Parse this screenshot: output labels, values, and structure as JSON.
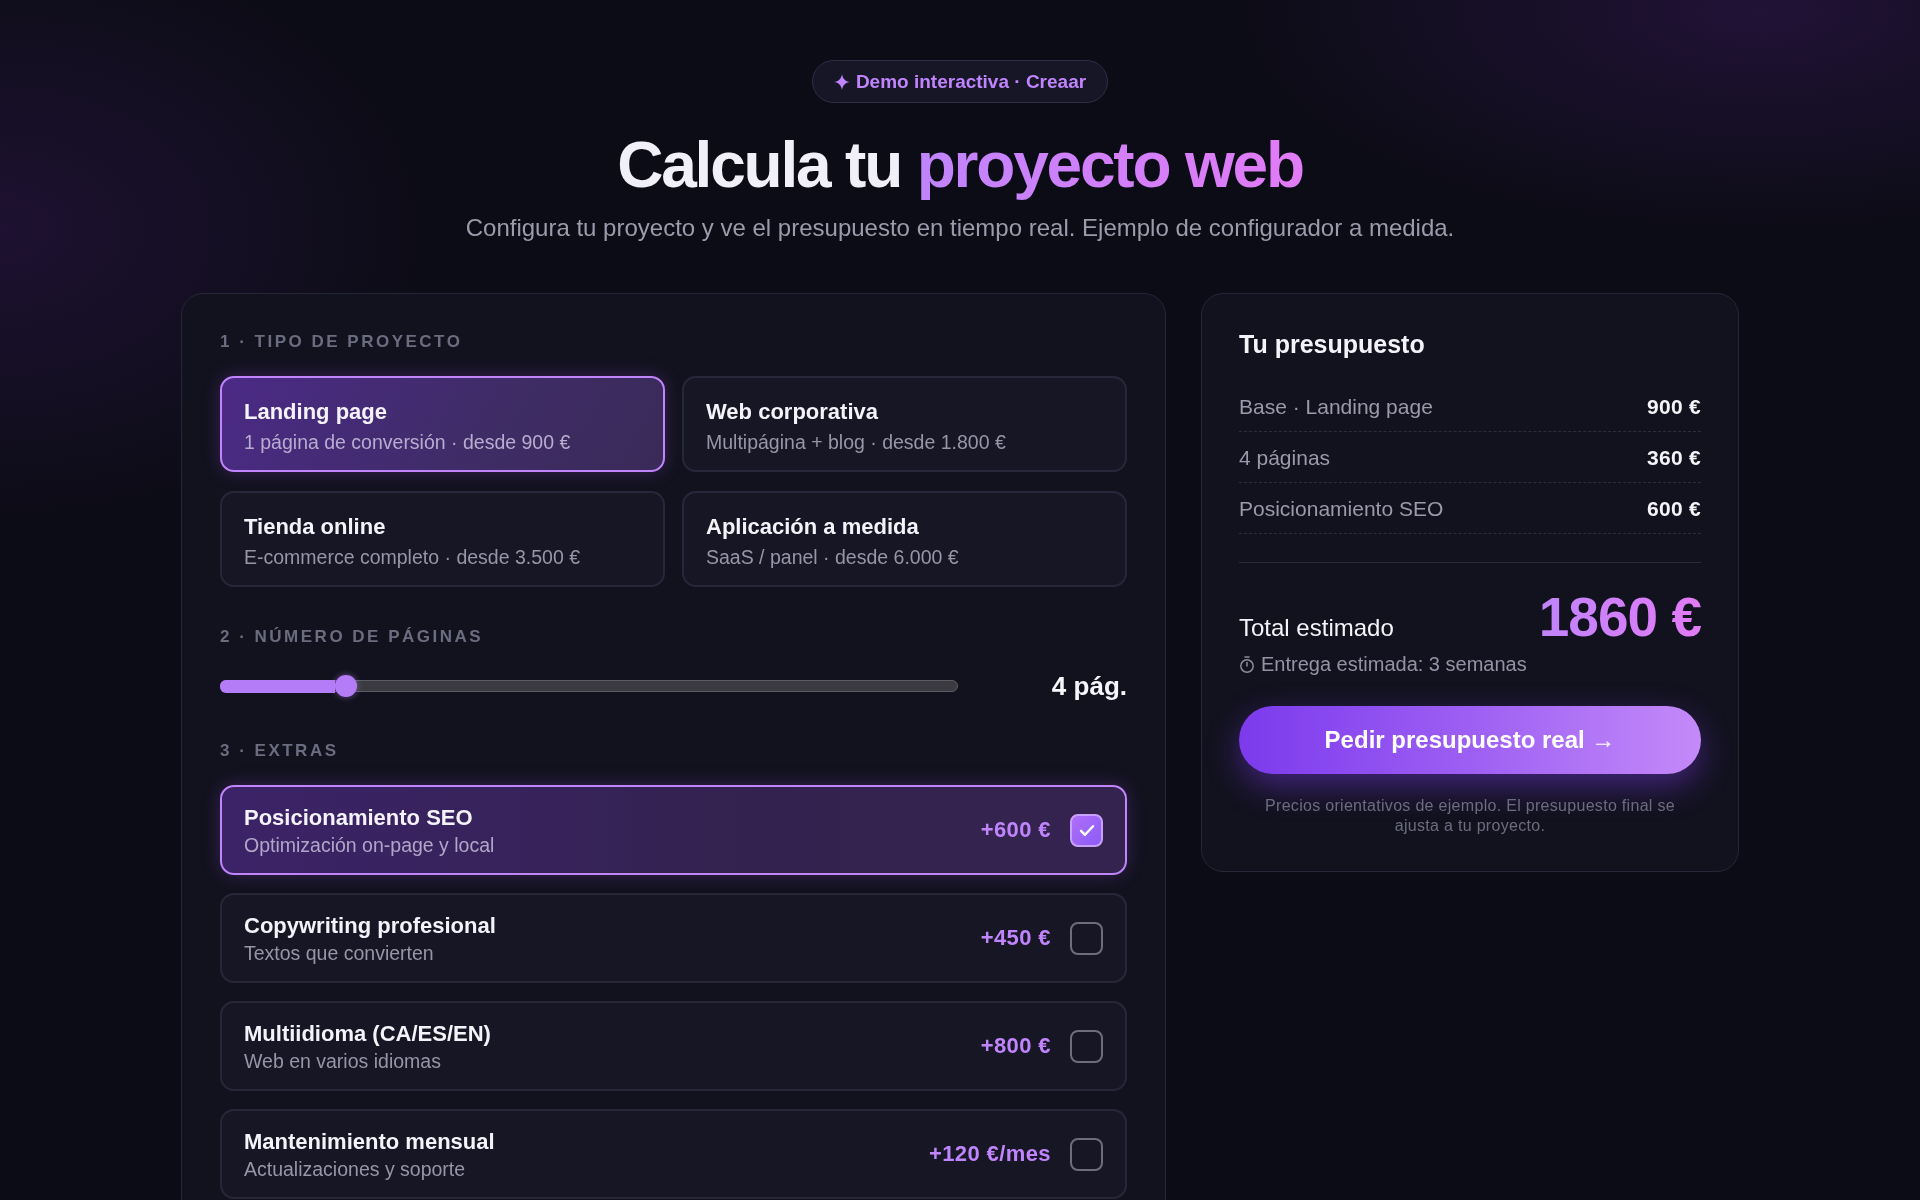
{
  "badge": {
    "text": "Demo interactiva · Creaar"
  },
  "title": {
    "text": "Calcula tu",
    "highlight": "proyecto web"
  },
  "subtitle": "Configura tu proyecto y ve el presupuesto en tiempo real. Ejemplo de configurador a medida.",
  "configurator": {
    "sections": [
      {
        "kind": "options",
        "label": "1 · TIPO DE PROYECTO",
        "options": [
          {
            "title": "Landing page",
            "description": "1 página de conversión · desde 900 €",
            "selected": true
          },
          {
            "title": "Web corporativa",
            "description": "Multipágina + blog · desde 1.800 €",
            "selected": false
          },
          {
            "title": "Tienda online",
            "description": "E-commerce completo · desde 3.500 €",
            "selected": false
          },
          {
            "title": "Aplicación a medida",
            "description": "SaaS / panel · desde 6.000 €",
            "selected": false
          }
        ]
      },
      {
        "kind": "slider",
        "label": "2 · NÚMERO DE PÁGINAS",
        "level": 0.17,
        "reading": "4 pág."
      },
      {
        "kind": "extras",
        "label": "3 · EXTRAS",
        "items": [
          {
            "title": "Posicionamiento SEO",
            "description": "Optimización on-page y local",
            "price": "+600 €",
            "checked": true
          },
          {
            "title": "Copywriting profesional",
            "description": "Textos que convierten",
            "price": "+450 €",
            "checked": false
          },
          {
            "title": "Multiidioma (CA/ES/EN)",
            "description": "Web en varios idiomas",
            "price": "+800 €",
            "checked": false
          },
          {
            "title": "Mantenimiento mensual",
            "description": "Actualizaciones y soporte",
            "price": "+120 €/mes",
            "checked": false
          }
        ]
      }
    ]
  },
  "summary": {
    "title": "Tu presupuesto",
    "lines": [
      {
        "label": "Base · Landing page",
        "amount": "900 €"
      },
      {
        "label": "4 páginas",
        "amount": "360 €"
      },
      {
        "label": "Posicionamiento SEO",
        "amount": "600 €"
      }
    ],
    "total": {
      "label": "Total estimado",
      "amount": "1860 €"
    },
    "delivery": "Entrega estimada: 3 semanas",
    "button": "Pedir presupuesto real →",
    "note": "Precios orientativos de ejemplo. El presupuesto final se ajusta a tu proyecto."
  }
}
